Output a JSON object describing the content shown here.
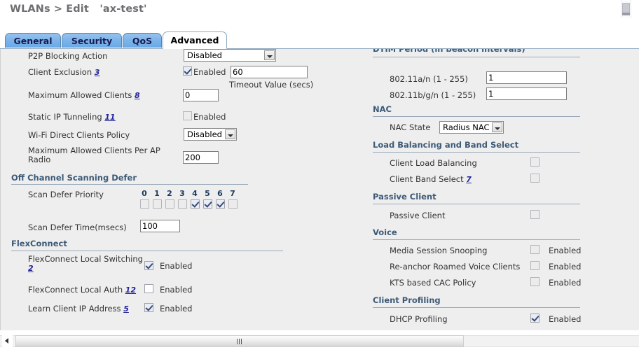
{
  "page": {
    "title_prefix": "WLANs > Edit",
    "title_name": "'ax-test'"
  },
  "tabs": [
    {
      "label": "General",
      "active": false
    },
    {
      "label": "Security",
      "active": false
    },
    {
      "label": "QoS",
      "active": false
    },
    {
      "label": "Advanced",
      "active": true
    }
  ],
  "left": {
    "p2p_blocking": {
      "label": "P2P Blocking Action",
      "value": "Disabled"
    },
    "client_exclusion": {
      "label": "Client Exclusion",
      "footnote": "3",
      "checked": true,
      "enabled_label": "Enabled",
      "timeout_value": "60",
      "timeout_caption": "Timeout Value (secs)"
    },
    "max_allowed_clients": {
      "label": "Maximum Allowed Clients",
      "footnote": "8",
      "value": "0"
    },
    "static_ip_tunneling": {
      "label": "Static IP Tunneling",
      "footnote": "11",
      "checked": false,
      "enabled_label": "Enabled"
    },
    "wifi_direct_policy": {
      "label": "Wi-Fi Direct Clients Policy",
      "value": "Disabled"
    },
    "max_clients_per_ap_radio": {
      "label": "Maximum Allowed Clients Per AP Radio",
      "value": "200"
    },
    "off_channel_scanning_defer": {
      "heading": "Off Channel Scanning Defer",
      "scan_defer_priority_label": "Scan Defer Priority",
      "priorities": [
        {
          "num": "0",
          "checked": false
        },
        {
          "num": "1",
          "checked": false
        },
        {
          "num": "2",
          "checked": false
        },
        {
          "num": "3",
          "checked": false
        },
        {
          "num": "4",
          "checked": true
        },
        {
          "num": "5",
          "checked": true
        },
        {
          "num": "6",
          "checked": true
        },
        {
          "num": "7",
          "checked": false
        }
      ],
      "scan_defer_time_label": "Scan Defer Time(msecs)",
      "scan_defer_time_value": "100"
    },
    "flexconnect": {
      "heading": "FlexConnect",
      "local_switching": {
        "label": "FlexConnect Local Switching",
        "footnote": "2",
        "checked": true,
        "enabled_label": "Enabled"
      },
      "local_auth": {
        "label": "FlexConnect Local Auth",
        "footnote": "12",
        "checked": false,
        "enabled_label": "Enabled"
      },
      "learn_client_ip": {
        "label": "Learn Client IP Address",
        "footnote": "5",
        "checked": true,
        "enabled_label": "Enabled"
      }
    }
  },
  "right": {
    "dtim": {
      "heading": "DTIM Period (in beacon intervals)",
      "a_n": {
        "label": "802.11a/n (1 - 255)",
        "value": "1"
      },
      "b_g_n": {
        "label": "802.11b/g/n (1 - 255)",
        "value": "1"
      }
    },
    "nac": {
      "heading": "NAC",
      "state_label": "NAC State",
      "state_value": "Radius NAC"
    },
    "load_balancing": {
      "heading": "Load Balancing and Band Select",
      "client_load_balancing": {
        "label": "Client Load Balancing",
        "checked": false
      },
      "client_band_select": {
        "label": "Client Band Select",
        "footnote": "7",
        "checked": false
      }
    },
    "passive_client": {
      "heading": "Passive Client",
      "passive_client": {
        "label": "Passive Client",
        "checked": false
      }
    },
    "voice": {
      "heading": "Voice",
      "media_session_snooping": {
        "label": "Media Session Snooping",
        "checked": false,
        "enabled_label": "Enabled"
      },
      "reanchor_roamed": {
        "label": "Re-anchor Roamed Voice Clients",
        "checked": false,
        "enabled_label": "Enabled"
      },
      "kts_cac": {
        "label": "KTS based CAC Policy",
        "checked": false,
        "enabled_label": "Enabled"
      }
    },
    "client_profiling": {
      "heading": "Client Profiling",
      "dhcp_profiling": {
        "label": "DHCP Profiling",
        "checked": true,
        "enabled_label": "Enabled"
      }
    }
  },
  "scrollbar": {
    "left_arrow": "scroll-left",
    "grip": "grip-icon"
  }
}
